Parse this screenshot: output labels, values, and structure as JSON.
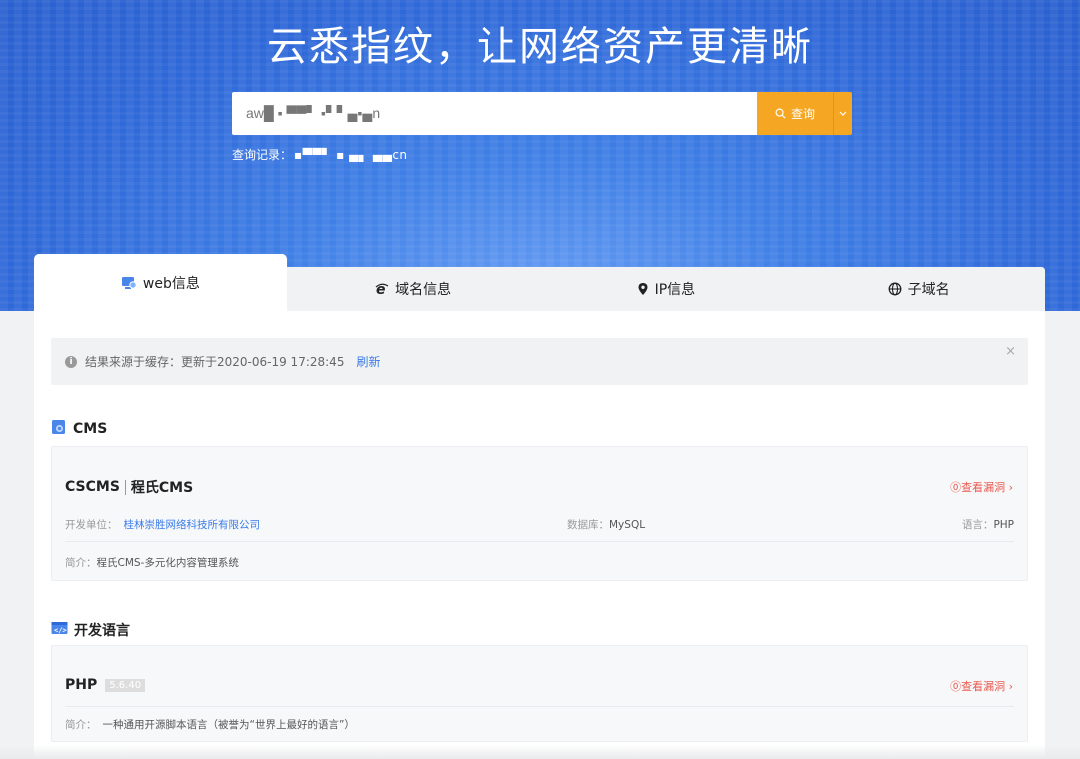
{
  "hero": {
    "title": "云悉指纹，让网络资产更清晰",
    "search_value": "aw█ ▪ ▀▀▘ ▪▘▘▄▪▄n",
    "search_button": "查询",
    "history_label": "查询记录：",
    "history_value": "▪▀▀▘  ▪ ▄▖ ▄▄cn"
  },
  "tabs": [
    {
      "label": "web信息",
      "icon": "monitor-icon"
    },
    {
      "label": "域名信息",
      "icon": "ie-icon"
    },
    {
      "label": "IP信息",
      "icon": "location-pin-icon"
    },
    {
      "label": "子域名",
      "icon": "globe-icon"
    }
  ],
  "notice": {
    "text": "结果来源于缓存：更新于2020-06-19 17:28:45",
    "refresh": "刷新",
    "close": "×"
  },
  "cms": {
    "heading": "CMS",
    "name": "CSCMS",
    "name_cn": "程氏CMS",
    "vuln_link": "⓪查看漏洞 ›",
    "developer_label": "开发单位：",
    "developer": "桂林崇胜网络科技所有限公司",
    "db_label": "数据库：",
    "db": "MySQL",
    "lang_label": "语言：",
    "lang": "PHP",
    "intro_label": "简介：",
    "intro": "程氏CMS-多元化内容管理系统"
  },
  "language": {
    "heading": "开发语言",
    "name": "PHP",
    "version": "5.6.40",
    "vuln_link": "⓪查看漏洞 ›",
    "intro_label": "简介：",
    "intro": "一种通用开源脚本语言（被誉为“世界上最好的语言”）"
  },
  "colors": {
    "hero_blue": "#3f7fe6",
    "accent_orange": "#f5a623",
    "link_blue": "#3b7be8",
    "vuln_red": "#e85a4f"
  }
}
